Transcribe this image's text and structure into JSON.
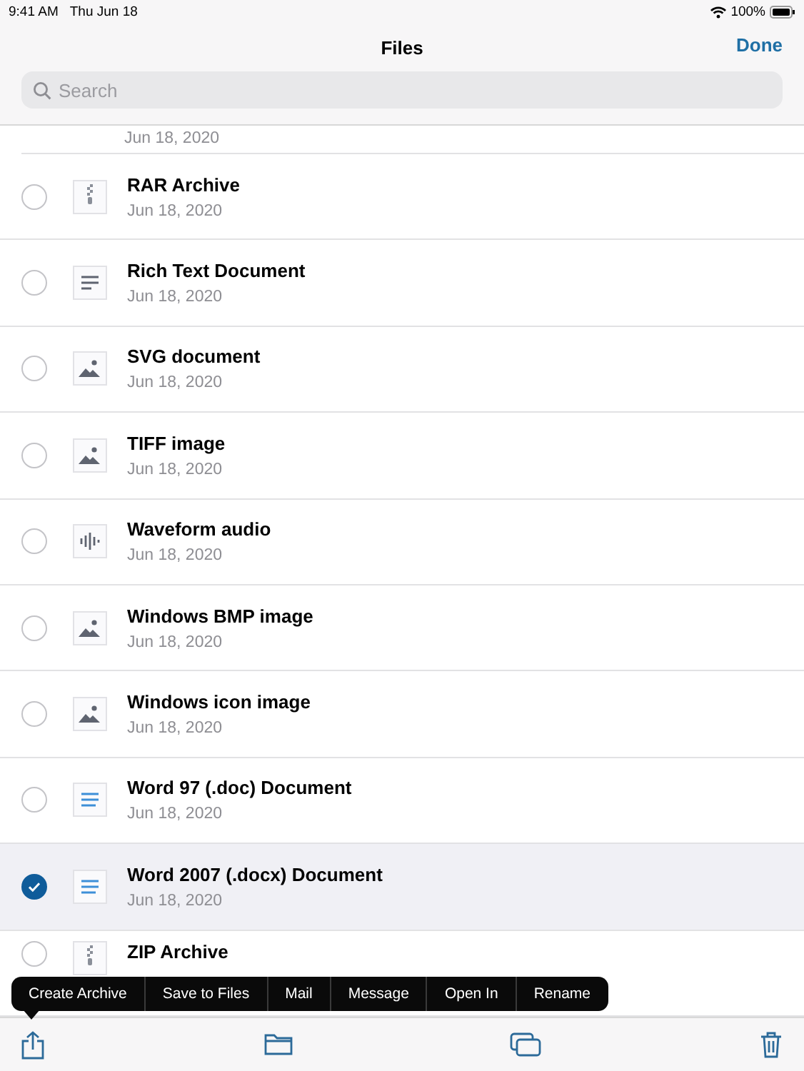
{
  "status_bar": {
    "time": "9:41 AM",
    "date": "Thu Jun 18",
    "battery": "100%"
  },
  "nav": {
    "title": "Files",
    "done": "Done"
  },
  "search": {
    "placeholder": "Search"
  },
  "partial_row": {
    "date": "Jun 18, 2020"
  },
  "files": [
    {
      "name": "RAR Archive",
      "date": "Jun 18, 2020",
      "kind": "archive",
      "selected": false
    },
    {
      "name": "Rich Text Document",
      "date": "Jun 18, 2020",
      "kind": "text",
      "selected": false
    },
    {
      "name": "SVG document",
      "date": "Jun 18, 2020",
      "kind": "image",
      "selected": false
    },
    {
      "name": "TIFF image",
      "date": "Jun 18, 2020",
      "kind": "image",
      "selected": false
    },
    {
      "name": "Waveform audio",
      "date": "Jun 18, 2020",
      "kind": "audio",
      "selected": false
    },
    {
      "name": "Windows BMP image",
      "date": "Jun 18, 2020",
      "kind": "image",
      "selected": false
    },
    {
      "name": "Windows icon image",
      "date": "Jun 18, 2020",
      "kind": "image",
      "selected": false
    },
    {
      "name": "Word 97 (.doc) Document",
      "date": "Jun 18, 2020",
      "kind": "word",
      "selected": false
    },
    {
      "name": "Word 2007 (.docx) Document",
      "date": "Jun 18, 2020",
      "kind": "word",
      "selected": true
    },
    {
      "name": "ZIP Archive",
      "kind": "archive",
      "selected": false
    }
  ],
  "menu": [
    "Create Archive",
    "Save to Files",
    "Mail",
    "Message",
    "Open In",
    "Rename"
  ]
}
